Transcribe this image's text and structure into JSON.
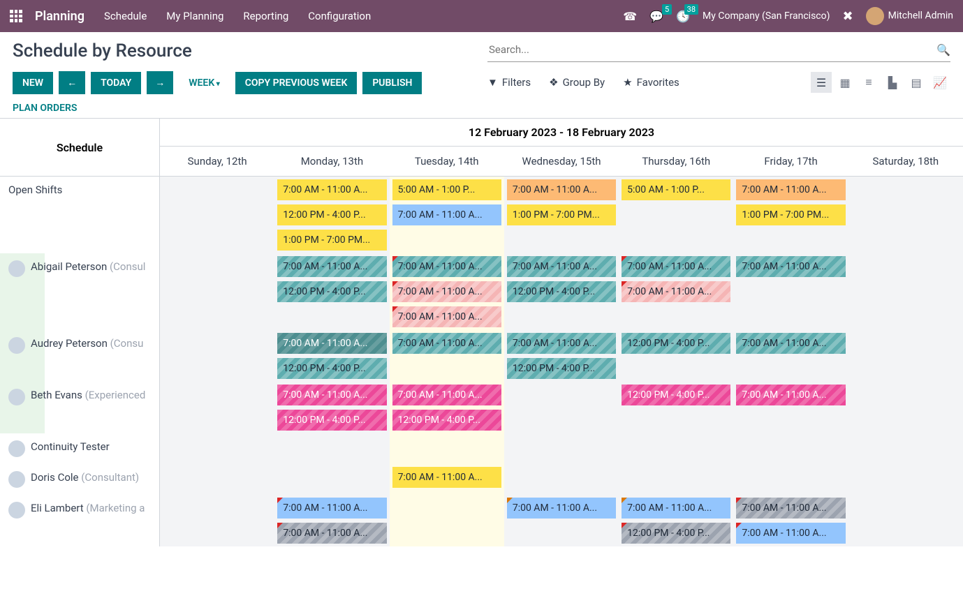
{
  "nav": {
    "brand": "Planning",
    "links": [
      "Schedule",
      "My Planning",
      "Reporting",
      "Configuration"
    ],
    "msg_count": "5",
    "activity_count": "38",
    "company": "My Company (San Francisco)",
    "user": "Mitchell Admin"
  },
  "page": {
    "title": "Schedule by Resource",
    "new": "NEW",
    "today": "TODAY",
    "week": "WEEK",
    "copy": "COPY PREVIOUS WEEK",
    "publish": "PUBLISH",
    "plan": "PLAN ORDERS"
  },
  "search": {
    "placeholder": "Search...",
    "filters": "Filters",
    "groupby": "Group By",
    "favorites": "Favorites"
  },
  "range": "12 February 2023 - 18 February 2023",
  "schedule_header": "Schedule",
  "days": [
    "Sunday, 12th",
    "Monday, 13th",
    "Tuesday, 14th",
    "Wednesday, 15th",
    "Thursday, 16th",
    "Friday, 17th",
    "Saturday, 18th"
  ],
  "rows": [
    {
      "name": "Open Shifts",
      "role": "",
      "avatar": false,
      "green": false,
      "cells": [
        [],
        [
          {
            "t": "7:00 AM - 11:00 A...",
            "c": "c-yellow"
          },
          {
            "t": "12:00 PM - 4:00 P...",
            "c": "c-yellow"
          },
          {
            "t": "1:00 PM - 7:00 PM...",
            "c": "c-yellow"
          }
        ],
        [
          {
            "t": "5:00 AM - 1:00 P...",
            "c": "c-yellow"
          },
          {
            "t": "7:00 AM - 11:00 A...",
            "c": "c-blue"
          }
        ],
        [
          {
            "t": "7:00 AM - 11:00 A...",
            "c": "c-orange"
          },
          {
            "t": "1:00 PM - 7:00 PM...",
            "c": "c-yellow"
          }
        ],
        [
          {
            "t": "5:00 AM - 1:00 P...",
            "c": "c-yellow"
          }
        ],
        [
          {
            "t": "7:00 AM - 11:00 A...",
            "c": "c-orange"
          },
          {
            "t": "1:00 PM - 7:00 PM...",
            "c": "c-yellow"
          }
        ],
        []
      ]
    },
    {
      "name": "Abigail Peterson",
      "role": " (Consul",
      "avatar": true,
      "green": true,
      "cells": [
        [],
        [
          {
            "t": "7:00 AM - 11:00 A...",
            "c": "c-teal"
          },
          {
            "t": "12:00 PM - 4:00 P...",
            "c": "c-teal"
          }
        ],
        [
          {
            "t": "7:00 AM - 11:00 A...",
            "c": "c-teal",
            "k": "corner"
          },
          {
            "t": "7:00 AM - 11:00 A...",
            "c": "c-salmon",
            "k": "corner"
          },
          {
            "t": "7:00 AM - 11:00 A...",
            "c": "c-salmon",
            "k": "corner"
          }
        ],
        [
          {
            "t": "7:00 AM - 11:00 A...",
            "c": "c-teal"
          },
          {
            "t": "12:00 PM - 4:00 P...",
            "c": "c-teal"
          }
        ],
        [
          {
            "t": "7:00 AM - 11:00 A...",
            "c": "c-teal",
            "k": "corner"
          },
          {
            "t": "7:00 AM - 11:00 A...",
            "c": "c-salmon",
            "k": "corner"
          }
        ],
        [
          {
            "t": "7:00 AM - 11:00 A...",
            "c": "c-teal"
          }
        ],
        []
      ]
    },
    {
      "name": "Audrey Peterson",
      "role": " (Consu",
      "avatar": true,
      "green": true,
      "cells": [
        [],
        [
          {
            "t": "7:00 AM - 11:00 A...",
            "c": "c-tealh"
          },
          {
            "t": "12:00 PM - 4:00 P...",
            "c": "c-teal"
          }
        ],
        [
          {
            "t": "7:00 AM - 11:00 A...",
            "c": "c-teal"
          }
        ],
        [
          {
            "t": "7:00 AM - 11:00 A...",
            "c": "c-teal"
          },
          {
            "t": "12:00 PM - 4:00 P...",
            "c": "c-teal"
          }
        ],
        [
          {
            "t": "12:00 PM - 4:00 P...",
            "c": "c-teal"
          }
        ],
        [
          {
            "t": "7:00 AM - 11:00 A...",
            "c": "c-teal"
          }
        ],
        []
      ]
    },
    {
      "name": "Beth Evans",
      "role": " (Experienced",
      "avatar": true,
      "green": true,
      "cells": [
        [],
        [
          {
            "t": "7:00 AM - 11:00 A...",
            "c": "c-pink"
          },
          {
            "t": "12:00 PM - 4:00 P...",
            "c": "c-pink"
          }
        ],
        [
          {
            "t": "7:00 AM - 11:00 A...",
            "c": "c-pink"
          },
          {
            "t": "12:00 PM - 4:00 P...",
            "c": "c-pink"
          }
        ],
        [],
        [
          {
            "t": "12:00 PM - 4:00 P...",
            "c": "c-pink"
          }
        ],
        [
          {
            "t": "7:00 AM - 11:00 A...",
            "c": "c-pink"
          }
        ],
        []
      ]
    },
    {
      "name": "Continuity Tester",
      "role": "",
      "avatar": true,
      "green": false,
      "cells": [
        [],
        [],
        [],
        [],
        [],
        [],
        []
      ]
    },
    {
      "name": "Doris Cole",
      "role": " (Consultant)",
      "avatar": true,
      "green": false,
      "cells": [
        [],
        [],
        [
          {
            "t": "7:00 AM - 11:00 A...",
            "c": "c-yellow"
          }
        ],
        [],
        [],
        [],
        []
      ]
    },
    {
      "name": "Eli Lambert",
      "role": " (Marketing a",
      "avatar": true,
      "green": false,
      "cells": [
        [],
        [
          {
            "t": "7:00 AM - 11:00 A...",
            "c": "c-blue",
            "k": "corner"
          },
          {
            "t": "7:00 AM - 11:00 A...",
            "c": "c-gray",
            "k": "corner"
          }
        ],
        [],
        [
          {
            "t": "7:00 AM - 11:00 A...",
            "c": "c-blue",
            "k": "corner-o"
          }
        ],
        [
          {
            "t": "7:00 AM - 11:00 A...",
            "c": "c-blue",
            "k": "corner-o"
          },
          {
            "t": "12:00 PM - 4:00 P...",
            "c": "c-gray",
            "k": "corner"
          }
        ],
        [
          {
            "t": "7:00 AM - 11:00 A...",
            "c": "c-gray",
            "k": "corner"
          },
          {
            "t": "7:00 AM - 11:00 A...",
            "c": "c-blue",
            "k": "corner"
          }
        ],
        []
      ]
    }
  ]
}
